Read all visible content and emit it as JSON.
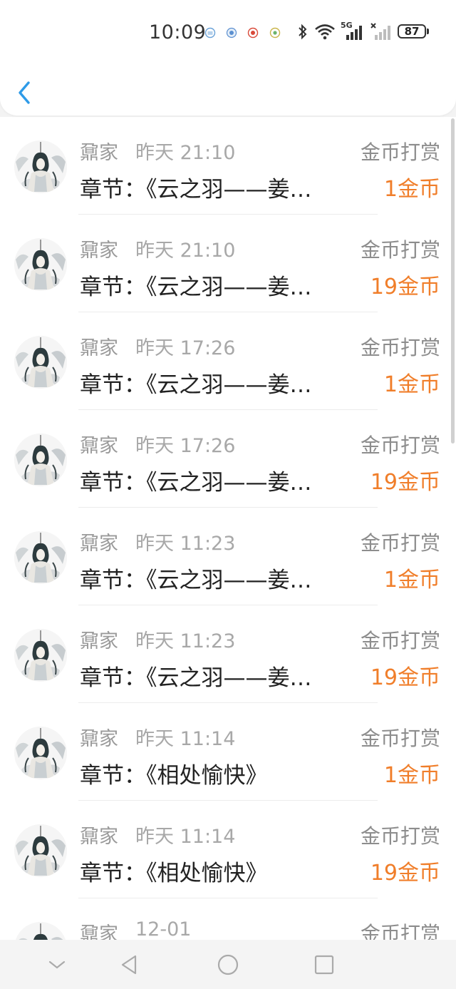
{
  "status_bar": {
    "time": "10:09",
    "network": "5G",
    "battery": "87",
    "icons": [
      "notification-icon",
      "notification-icon",
      "notification-icon",
      "notification-icon",
      "bluetooth-icon",
      "wifi-icon",
      "signal-icon",
      "signal-off-icon",
      "battery-icon"
    ]
  },
  "header": {
    "back_icon": "chevron-left-icon"
  },
  "colors": {
    "accent": "#2e9be8",
    "amount": "#f07e2a",
    "muted": "#9a9a9a"
  },
  "records": [
    {
      "name": "鼐家",
      "time": "昨天 21:10",
      "type": "金币打赏",
      "chapter": "章节：《云之羽——姜…",
      "amount": "1金币"
    },
    {
      "name": "鼐家",
      "time": "昨天 21:10",
      "type": "金币打赏",
      "chapter": "章节：《云之羽——姜…",
      "amount": "19金币"
    },
    {
      "name": "鼐家",
      "time": "昨天 17:26",
      "type": "金币打赏",
      "chapter": "章节：《云之羽——姜…",
      "amount": "1金币"
    },
    {
      "name": "鼐家",
      "time": "昨天 17:26",
      "type": "金币打赏",
      "chapter": "章节：《云之羽——姜…",
      "amount": "19金币"
    },
    {
      "name": "鼐家",
      "time": "昨天 11:23",
      "type": "金币打赏",
      "chapter": "章节：《云之羽——姜…",
      "amount": "1金币"
    },
    {
      "name": "鼐家",
      "time": "昨天 11:23",
      "type": "金币打赏",
      "chapter": "章节：《云之羽——姜…",
      "amount": "19金币"
    },
    {
      "name": "鼐家",
      "time": "昨天 11:14",
      "type": "金币打赏",
      "chapter": "章节：《相处愉快》",
      "amount": "1金币"
    },
    {
      "name": "鼐家",
      "time": "昨天 11:14",
      "type": "金币打赏",
      "chapter": "章节：《相处愉快》",
      "amount": "19金币"
    },
    {
      "name": "鼐家",
      "time": "12-01",
      "type": "金币打赏",
      "chapter": "",
      "amount": ""
    }
  ],
  "nav_bar": [
    "chevron-down-icon",
    "back-triangle-icon",
    "home-circle-icon",
    "recents-square-icon"
  ]
}
